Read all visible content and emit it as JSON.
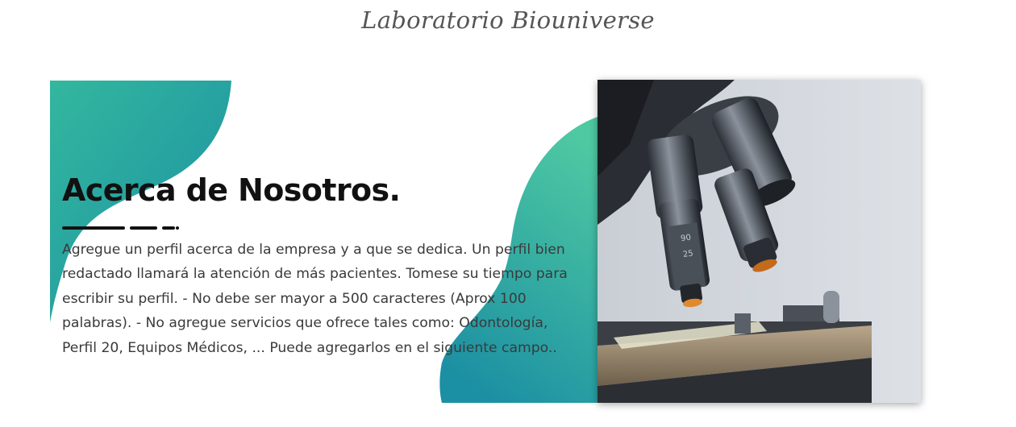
{
  "site": {
    "title": "Laboratorio Biouniverse"
  },
  "about": {
    "heading": "Acerca de Nosotros.",
    "body": "Agregue un perfil acerca de la empresa y a que se dedica. Un perfil bien redactado llamará la atención de más pacientes. Tomese su tiempo para escribir su perfil. - No debe ser mayor a 500 caracteres (Aprox 100 palabras). - No agregue servicios que ofrece tales como: Odontología, Perfil 20, Equipos Médicos, ... Puede agregarlos en el siguiente campo..",
    "image": {
      "subject": "microscope-photo",
      "objective_labels": [
        "90",
        "25"
      ]
    }
  },
  "colors": {
    "gradient_start": "#1b8fa3",
    "gradient_end": "#4ec9a2",
    "heading": "#111111",
    "body_text": "#3a3a3a",
    "title_text": "#555555"
  }
}
